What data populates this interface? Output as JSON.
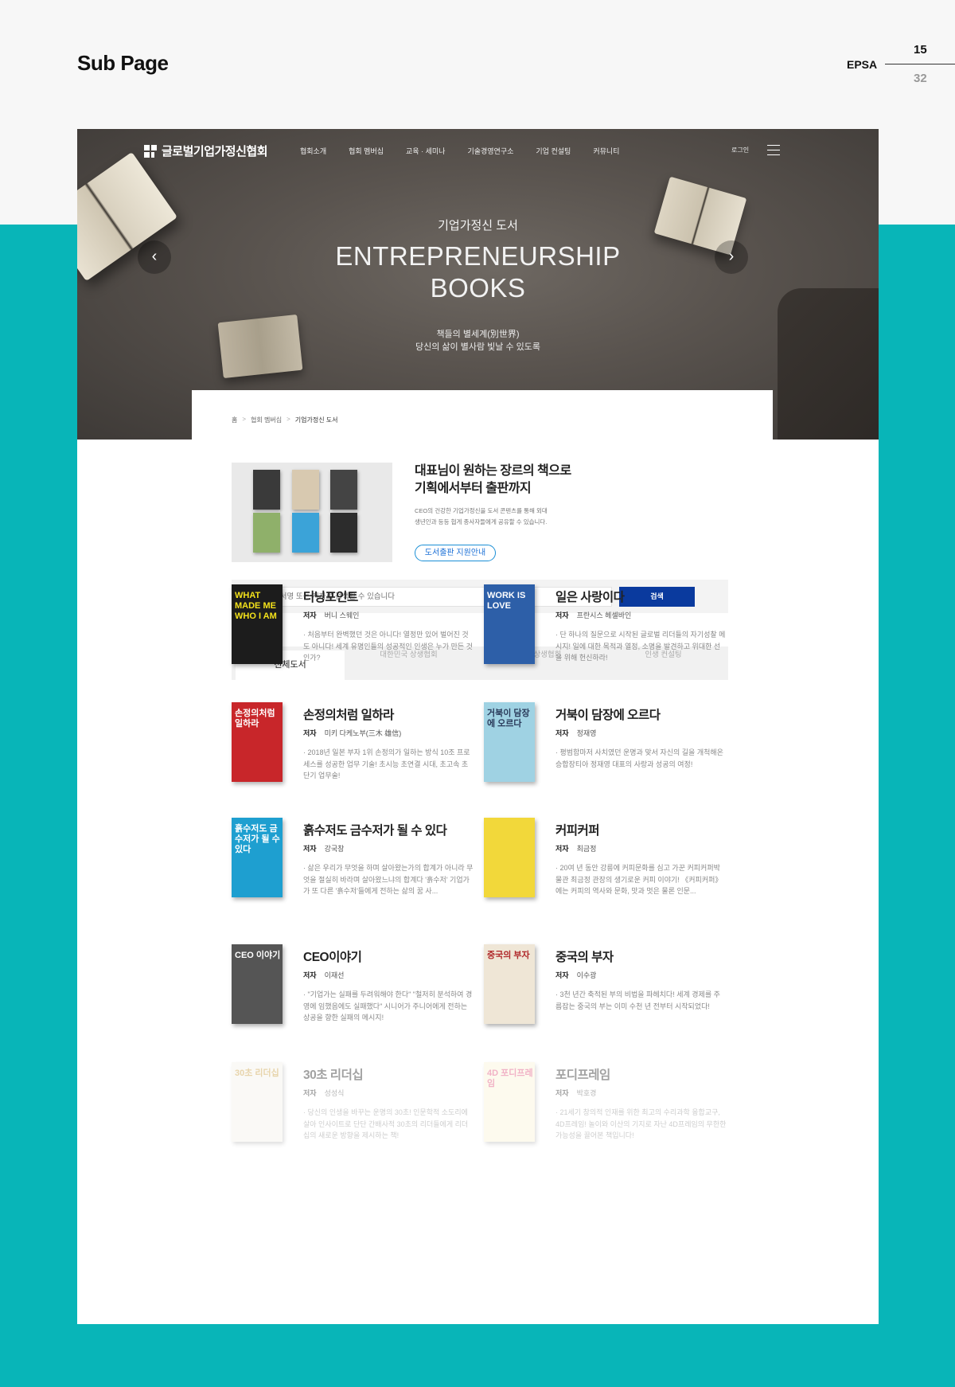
{
  "sheet": {
    "title": "Sub Page",
    "brand": "EPSA",
    "page_current": "15",
    "page_total": "32"
  },
  "gnb": {
    "logo": "글로벌기업가정신협회",
    "menu": [
      "협회소개",
      "협회 멤버십",
      "교육 · 세미나",
      "기술경영연구소",
      "기업 컨설팅",
      "커뮤니티"
    ],
    "login": "로그인"
  },
  "hero": {
    "subtitle": "기업가정신 도서",
    "title_line1": "ENTREPRENEURSHIP",
    "title_line2": "BOOKS",
    "desc_line1": "책들의 별세계(別世界)",
    "desc_line2": "당신의 삶이 별사람 빛날 수 있도록"
  },
  "breadcrumb": {
    "home": "홈",
    "level1": "협회 멤버십",
    "current": "기업가정신 도서"
  },
  "intro": {
    "title_line1": "대표님이 원하는 장르의 책으로",
    "title_line2": "기획에서부터 출판까지",
    "desc_line1": "CEO의 건강한 기업가정신을 도서 콘텐츠를 통해 외대",
    "desc_line2": "생년인과 등등 협게 종사자들에게 공유할 수 있습니다.",
    "button": "도서출판 지원안내"
  },
  "search": {
    "placeholder": "도서명 또는 저자로 검색할 수 있습니다",
    "button": "검색"
  },
  "tabs": [
    "전체도서",
    "대한민국 상생협회",
    "글로벌 상생협회",
    "인생 컨설팅"
  ],
  "author_label": "저자",
  "books": [
    {
      "title": "터닝포인트",
      "author": "버니 스웨인",
      "desc": "· 처음부터 완벽했던 것은 아니다! 열정만 있어 벌어진 것도 아니다! 세계 유명인들의 성공적인 인생은 누가 만든 것인가?",
      "cover_color": "#1c1c1c",
      "cover_text": "WHAT MADE ME WHO I AM",
      "cover_text_color": "#f4e21b"
    },
    {
      "title": "일은 사랑이다",
      "author": "프란시스 헤셀바인",
      "desc": "· 단 하나의 질문으로 시작된 글로벌 리더들의 자기성찰 메시지! 일에 대한 목적과 열정, 소명을 발견하고 위대한 선을 위해 헌신하라!",
      "cover_color": "#2d5fa8",
      "cover_text": "WORK IS LOVE",
      "cover_text_color": "#ffffff"
    },
    {
      "title": "손정의처럼 일하라",
      "author": "미키 다케노부(三木 雄信)",
      "desc": "· 2018년 일본 부자 1위 손정의가 일하는 방식 10조 프로세스를 성공한 업무 기술! 초시능 초연결 시대, 초고속 초단기 업무술!",
      "cover_color": "#c8262a",
      "cover_text": "손정의처럼 일하라",
      "cover_text_color": "#ffffff"
    },
    {
      "title": "거북이 담장에 오르다",
      "author": "정재영",
      "desc": "· 평범함마저 사치였던 운명과 맞서 자신의 길을 개척해온 승합장티아 정재영 대표의 사랑과 성공의 여정!",
      "cover_color": "#9fd2e3",
      "cover_text": "거북이 담장에 오르다",
      "cover_text_color": "#2a3a5a"
    },
    {
      "title": "흙수저도 금수저가 될 수 있다",
      "author": "강국창",
      "desc": "· 삶은 우리가 무엇을 하며 살아왔는가의 합계가 아니라 무엇을 절실히 바라며 살아왔느냐의 합계다 '흙수저' 기업가가 또 다른 '흙수저'들에게 전하는 삶의 꿈 사...",
      "cover_color": "#1e9fd0",
      "cover_text": "흙수저도 금수저가 될 수 있다",
      "cover_text_color": "#ffffff"
    },
    {
      "title": "커피커퍼",
      "author": "최금정",
      "desc": "· 20여 년 동안 강릉에 커피문화를 심고 가꾼 커피커퍼박물관 최금정 관장의 생기로운 커피 이야기! 《커피커퍼》에는 커피의 역사와 문화, 맛과 멋은 물론 인문...",
      "cover_color": "#f2d83a",
      "cover_text": "",
      "cover_text_color": "#333333"
    },
    {
      "title": "CEO이야기",
      "author": "이재선",
      "desc": "· \"기업가는 실패를 두려워해야 한다\" \"철저히 분석하여 경영에 임했음에도 실패했다\" 시니어가 주니어에게 전하는 상공을 향한 실패의 메시지!",
      "cover_color": "#555555",
      "cover_text": "CEO 이야기",
      "cover_text_color": "#ffffff"
    },
    {
      "title": "중국의 부자",
      "author": "이수광",
      "desc": "· 3천 년간 축적된 부의 비법을 파헤치다! 세계 경제를 주름잡는 중국의 부는 이미 수천 년 전부터 시작되었다!",
      "cover_color": "#efe6d6",
      "cover_text": "중국의 부자",
      "cover_text_color": "#b0282a"
    },
    {
      "title": "30초 리더십",
      "author": "성성식",
      "desc": "· 당신의 인생을 바꾸는 운명의 30초! 인문학적 소도리에 살아 인사이트로 단단 간배사적 30초의 리더들에게 리더십의 새로운 방향을 제시하는 책!",
      "cover_color": "#f5f2ea",
      "cover_text": "30초 리더십",
      "cover_text_color": "#c89a3a"
    },
    {
      "title": "포디프레임",
      "author": "박호경",
      "desc": "· 21세기 창의적 인재를 위한 최고의 수리과학 융합교구, 4D프레임! 놀이와 이산의 기지로 자난 4D프레임의 무한한 가능성을 끌어본 책입니다!",
      "cover_color": "#fbf4d8",
      "cover_text": "4D 포디프레임",
      "cover_text_color": "#e04a7a"
    }
  ]
}
